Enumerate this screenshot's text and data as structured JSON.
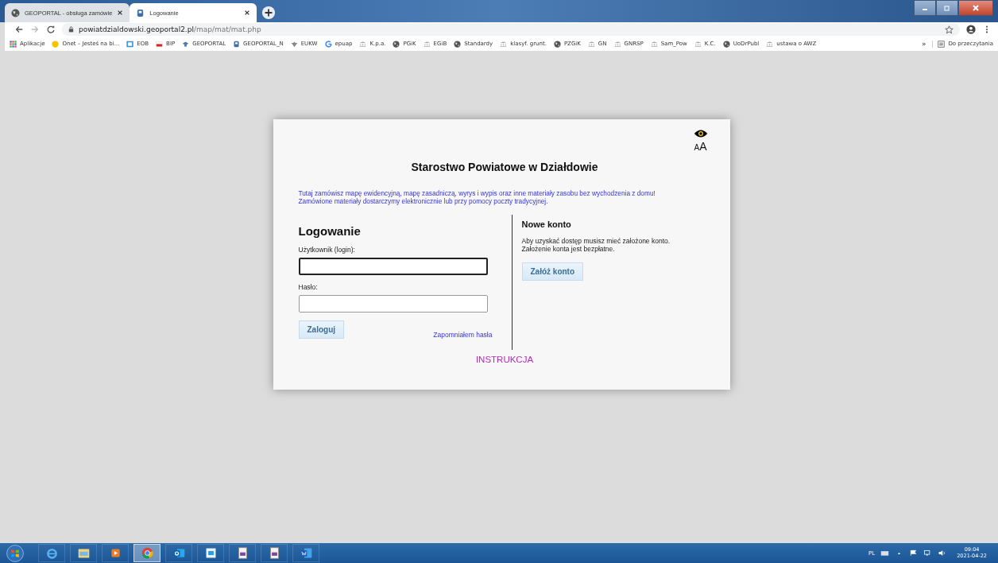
{
  "tabs": [
    {
      "title": "GEOPORTAL - obsługa zamówie",
      "selected": false,
      "kind": "globe"
    },
    {
      "title": "Logowanie",
      "selected": true,
      "kind": "gletter"
    }
  ],
  "address": {
    "host": "powiatdzialdowski.geoportal2.pl",
    "path": "/map/mat/mat.php"
  },
  "bookmarks": [
    {
      "label": "Aplikacje",
      "kind": "apps"
    },
    {
      "label": "Onet – Jesteś na bi...",
      "kind": "dot"
    },
    {
      "label": "EOB",
      "kind": "square"
    },
    {
      "label": "BIP",
      "kind": "flag"
    },
    {
      "label": "GEOPORTAL",
      "kind": "cap"
    },
    {
      "label": "GEOPORTAL_N",
      "kind": "gletter"
    },
    {
      "label": "EUKW",
      "kind": "eagle"
    },
    {
      "label": "epuap",
      "kind": "google"
    },
    {
      "label": "K.p.a.",
      "kind": "bank"
    },
    {
      "label": "PGiK",
      "kind": "globe"
    },
    {
      "label": "EGiB",
      "kind": "bank"
    },
    {
      "label": "Standardy",
      "kind": "globe"
    },
    {
      "label": "klasyf. grunt.",
      "kind": "bank"
    },
    {
      "label": "PZGiK",
      "kind": "globe"
    },
    {
      "label": "GN",
      "kind": "bank"
    },
    {
      "label": "GNRSP",
      "kind": "bank"
    },
    {
      "label": "Sam_Pow",
      "kind": "bank"
    },
    {
      "label": "K.C.",
      "kind": "bank"
    },
    {
      "label": "UoDrPubl",
      "kind": "globe"
    },
    {
      "label": "ustawa o AWZ",
      "kind": "bank"
    }
  ],
  "more_bookmarks": "»",
  "reading_list": "Do przeczytania",
  "dialog": {
    "title": "Starostwo Powiatowe w Działdowie",
    "intro": [
      "Tutaj zamówisz mapę ewidencyjną, mapę zasadniczą, wyrys i wypis oraz inne materiały zasobu bez wychodzenia z domu!",
      "Zamówione materiały dostarczymy elektronicznie lub przy pomocy poczty tradycyjnej."
    ],
    "font_size_toggle": {
      "small": "A",
      "large": "A"
    },
    "login": {
      "heading": "Logowanie",
      "fields": [
        {
          "label": "Użytkownik (login):",
          "focused": true
        },
        {
          "label": "Hasło:",
          "focused": false
        }
      ],
      "button": "Zaloguj",
      "forgot_link": "Zapomniałem hasła"
    },
    "register": {
      "heading": "Nowe konto",
      "text": [
        "Aby uzyskać dostęp musisz mieć założone konto.",
        "Założenie konta jest bezpłatne."
      ],
      "button": "Załóż konto"
    },
    "instructions_link": "INSTRUKCJA"
  },
  "taskbar": {
    "apps": [
      {
        "kind": "ie",
        "selected": false
      },
      {
        "kind": "folder",
        "selected": false
      },
      {
        "kind": "player",
        "selected": false
      },
      {
        "kind": "chrome",
        "selected": true
      },
      {
        "kind": "outlook",
        "selected": false
      },
      {
        "kind": "screen",
        "selected": false
      },
      {
        "kind": "doc",
        "selected": false
      },
      {
        "kind": "doc",
        "selected": false
      },
      {
        "kind": "word",
        "selected": false
      }
    ],
    "language": "PL",
    "time": "09:04",
    "date": "2021-04-22"
  }
}
